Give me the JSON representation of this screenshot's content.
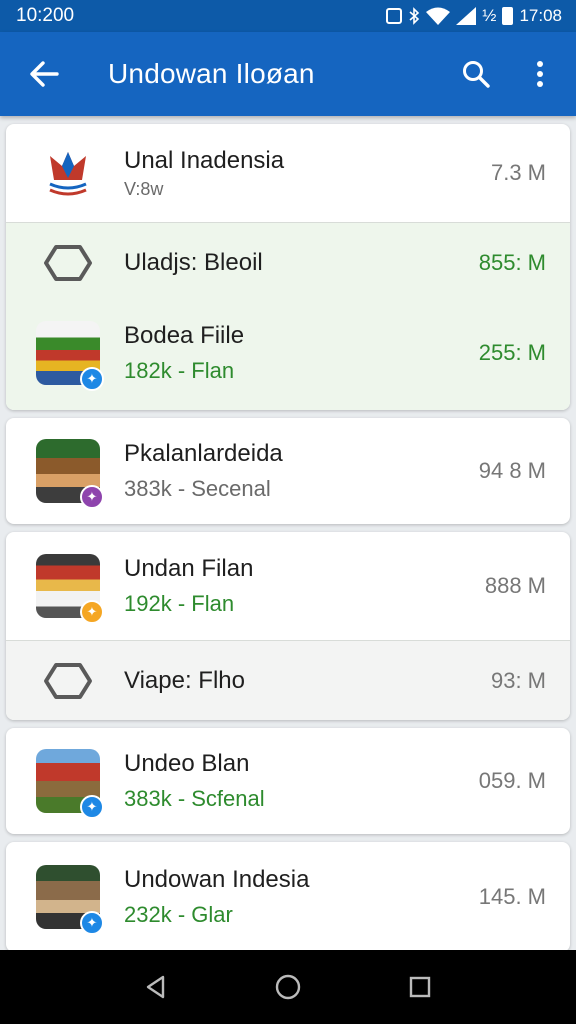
{
  "status_bar": {
    "time": "10:200",
    "icons_text": "½",
    "clock_right": "17:08"
  },
  "app_bar": {
    "title": "Undowan Iloøan"
  },
  "items": [
    {
      "name": "Unal Inadensia",
      "sub": "V:8w",
      "distance": "7.3  M"
    },
    {
      "name": "Uladjs: Bleoil",
      "sub": "",
      "distance": "855: M"
    },
    {
      "name": "Bodea Fiile",
      "sub": "182k - Flan",
      "distance": "255: M"
    },
    {
      "name": "Pkalanlardeida",
      "sub": "383k - Secenal",
      "distance": "94 8 M"
    },
    {
      "name": "Undan Filan",
      "sub": "192k - Flan",
      "distance": "888 M"
    },
    {
      "name": "Viape: Flho",
      "sub": "",
      "distance": "93: M"
    },
    {
      "name": "Undeo Blan",
      "sub": "383k - Scfenal",
      "distance": "059. M"
    },
    {
      "name": "Undowan Indesia",
      "sub": "232k - Glar",
      "distance": "145. M"
    }
  ],
  "colors": {
    "appbar": "#1565c0",
    "statusbar": "#0d5aa8",
    "green_text": "#2e8b2e",
    "badge_blue": "#1e88e5",
    "badge_purple": "#8e44ad",
    "badge_yellow": "#f5a623"
  },
  "icons": [
    "back-arrow-icon",
    "search-icon",
    "more-vert-icon",
    "hexagon-icon",
    "star-badge-icon",
    "nav-back-icon",
    "nav-home-icon",
    "nav-recents-icon"
  ]
}
